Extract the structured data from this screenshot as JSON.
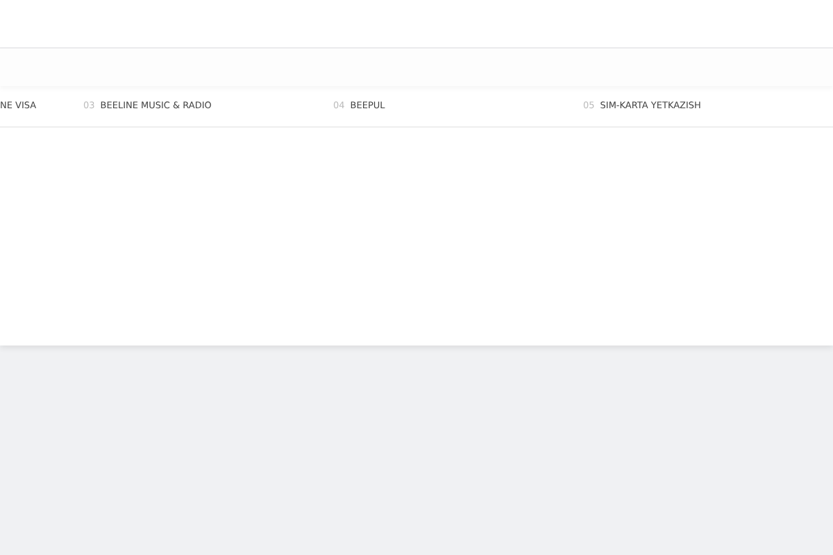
{
  "tabs": [
    {
      "label": "NE VISA"
    },
    {
      "number": "03",
      "label": "BEELINE MUSIC & RADIO"
    },
    {
      "number": "04",
      "label": "BEEPUL"
    },
    {
      "number": "05",
      "label": "SIM-KARTA YETKAZISH"
    }
  ]
}
